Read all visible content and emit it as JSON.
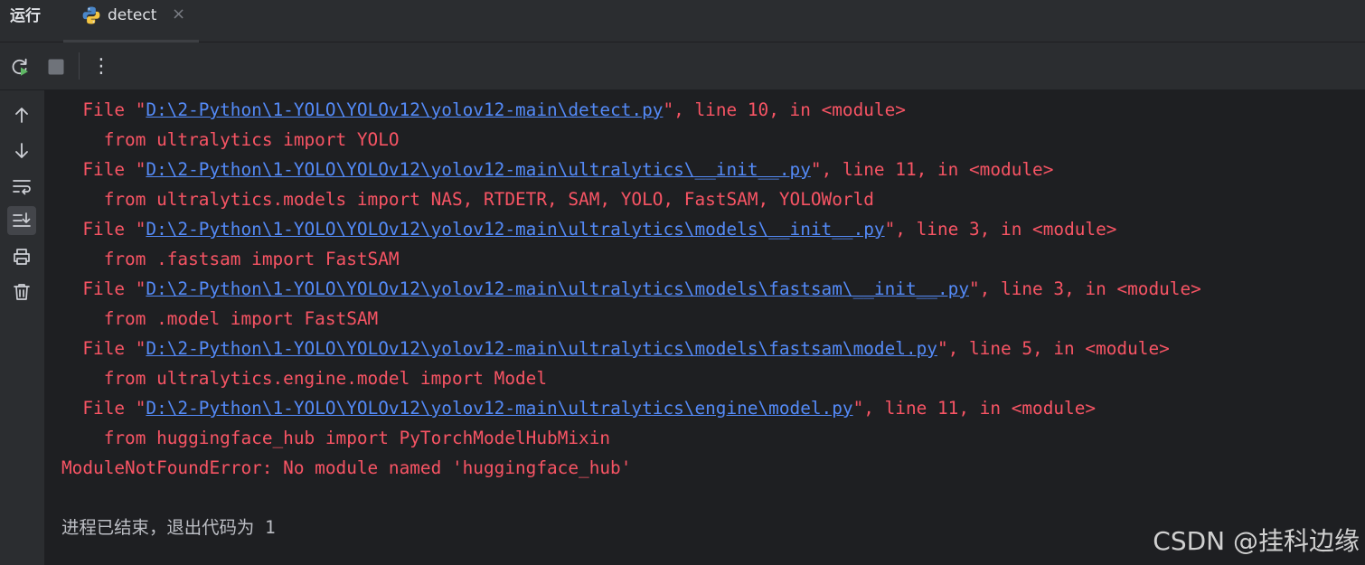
{
  "panel_title": "运行",
  "tab": {
    "label": "detect",
    "close": "×"
  },
  "toolbar": {
    "more": "⋮"
  },
  "console": {
    "traceback": [
      {
        "indent": "  ",
        "prefix": "File \"",
        "path": "D:\\2-Python\\1-YOLO\\YOLOv12\\yolov12-main\\detect.py",
        "suffix": "\", line 10, in <module>"
      },
      {
        "indent": "    ",
        "code": "from ultralytics import YOLO"
      },
      {
        "indent": "  ",
        "prefix": "File \"",
        "path": "D:\\2-Python\\1-YOLO\\YOLOv12\\yolov12-main\\ultralytics\\__init__.py",
        "suffix": "\", line 11, in <module>"
      },
      {
        "indent": "    ",
        "code": "from ultralytics.models import NAS, RTDETR, SAM, YOLO, FastSAM, YOLOWorld"
      },
      {
        "indent": "  ",
        "prefix": "File \"",
        "path": "D:\\2-Python\\1-YOLO\\YOLOv12\\yolov12-main\\ultralytics\\models\\__init__.py",
        "suffix": "\", line 3, in <module>"
      },
      {
        "indent": "    ",
        "code": "from .fastsam import FastSAM"
      },
      {
        "indent": "  ",
        "prefix": "File \"",
        "path": "D:\\2-Python\\1-YOLO\\YOLOv12\\yolov12-main\\ultralytics\\models\\fastsam\\__init__.py",
        "suffix": "\", line 3, in <module>"
      },
      {
        "indent": "    ",
        "code": "from .model import FastSAM"
      },
      {
        "indent": "  ",
        "prefix": "File \"",
        "path": "D:\\2-Python\\1-YOLO\\YOLOv12\\yolov12-main\\ultralytics\\models\\fastsam\\model.py",
        "suffix": "\", line 5, in <module>"
      },
      {
        "indent": "    ",
        "code": "from ultralytics.engine.model import Model"
      },
      {
        "indent": "  ",
        "prefix": "File \"",
        "path": "D:\\2-Python\\1-YOLO\\YOLOv12\\yolov12-main\\ultralytics\\engine\\model.py",
        "suffix": "\", line 11, in <module>"
      },
      {
        "indent": "    ",
        "code": "from huggingface_hub import PyTorchModelHubMixin"
      }
    ],
    "error": "ModuleNotFoundError: No module named 'huggingface_hub'",
    "exit_message": "进程已结束，退出代码为 1"
  },
  "watermark": "CSDN @挂科边缘"
}
